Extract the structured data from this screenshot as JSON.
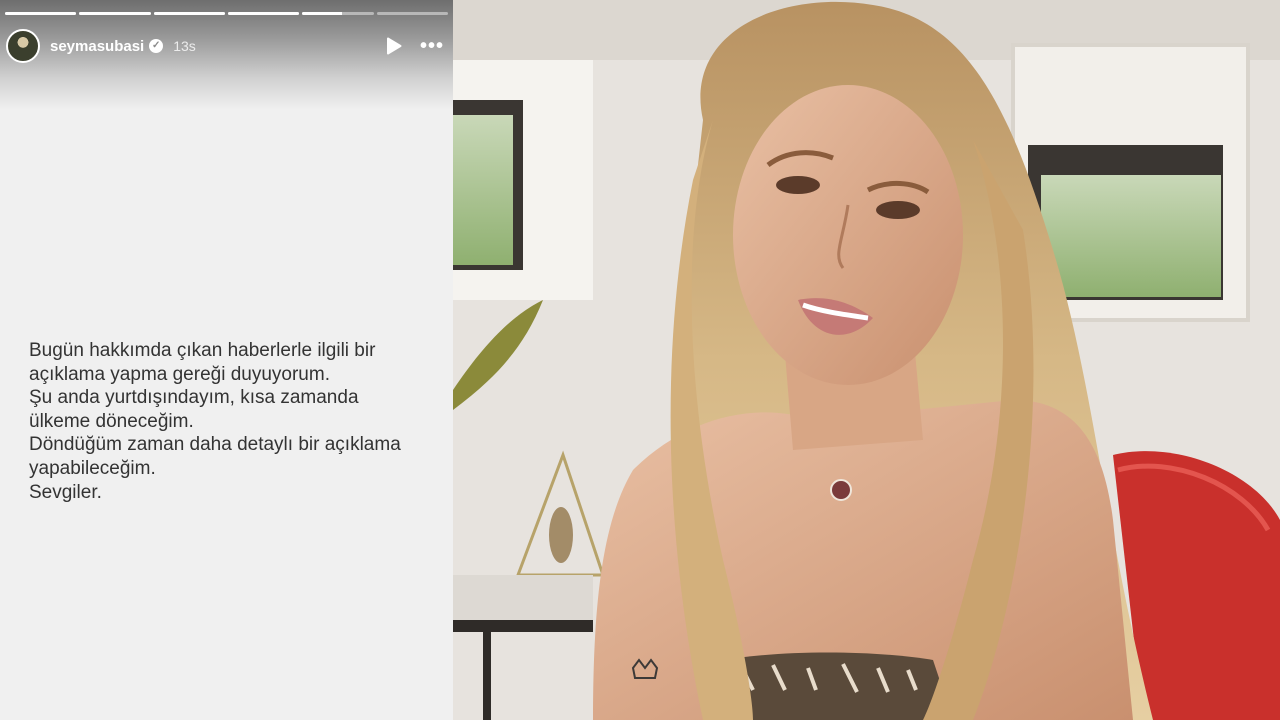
{
  "story": {
    "username": "seymasubasi",
    "time_ago": "13s",
    "verified_icon": "check-icon",
    "play_icon": "play-icon",
    "more_icon": "more-horizontal-icon",
    "progress": [
      1,
      1,
      1,
      1,
      0.55,
      0
    ],
    "message_lines": [
      "Bugün hakkımda çıkan haberlerle ilgili bir",
      "açıklama yapma gereği duyuyorum.",
      "Şu anda yurtdışındayım, kısa zamanda",
      "ülkeme döneceğim.",
      "Döndüğüm zaman daha detaylı bir açıklama",
      "yapabileceğim.",
      "Sevgiler."
    ]
  },
  "photo": {
    "wall_color": "#e9e6e1",
    "chair_color": "#c9302c",
    "hair_color": "#caa675"
  }
}
